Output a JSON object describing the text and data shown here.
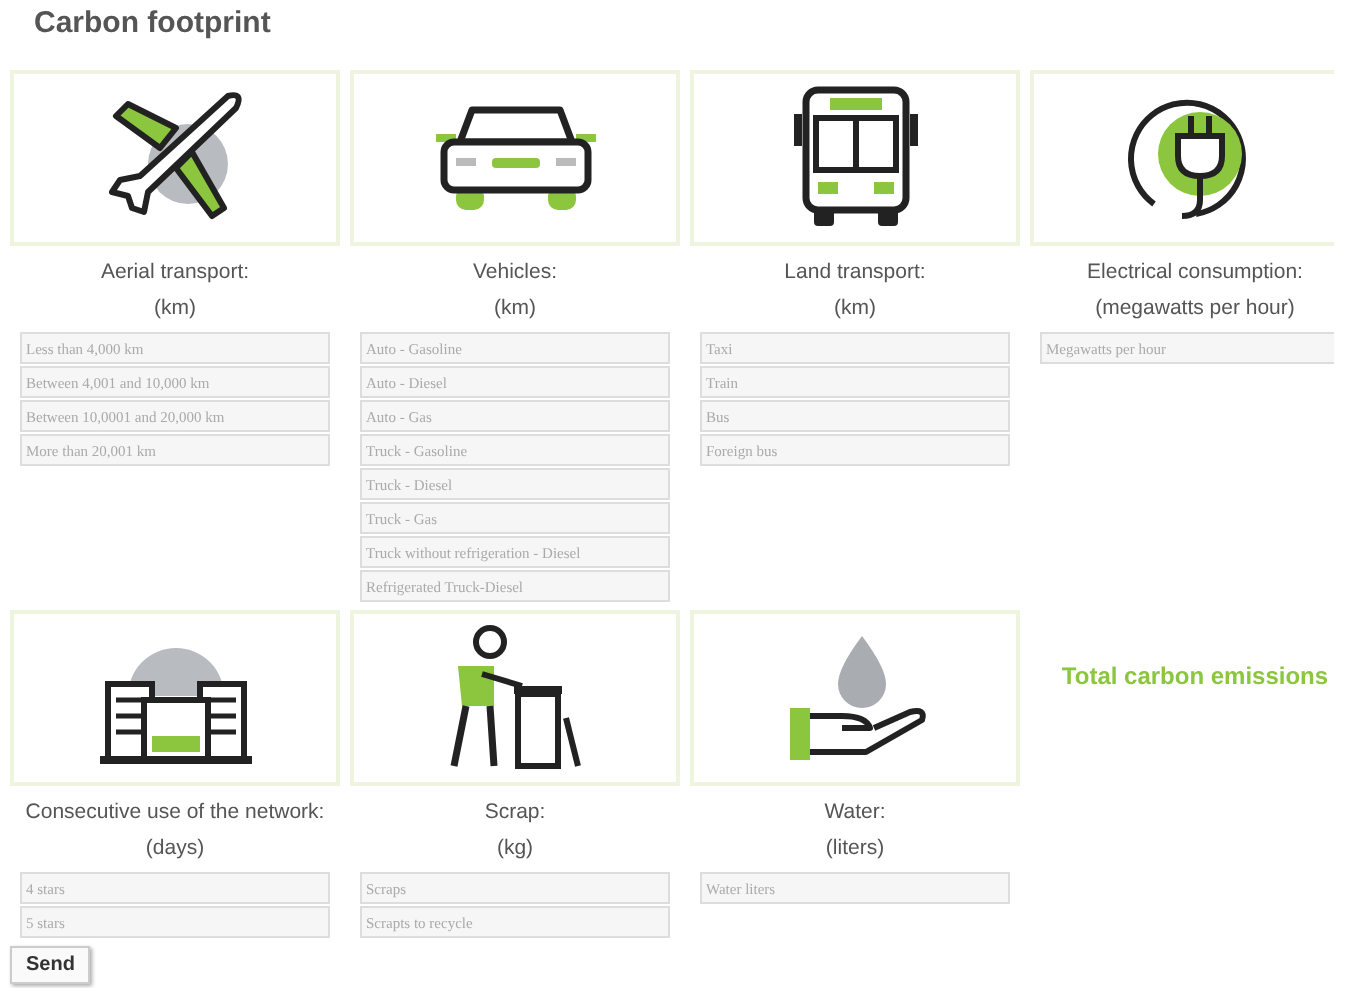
{
  "title": "Carbon footprint",
  "categories": [
    {
      "kind": "plane",
      "label": "Aerial transport:",
      "unit": "(km)",
      "fields": [
        {
          "placeholder": "Less than 4,000 km"
        },
        {
          "placeholder": "Between 4,001 and 10,000 km"
        },
        {
          "placeholder": "Between 10,0001 and 20,000 km"
        },
        {
          "placeholder": "More than 20,001 km"
        }
      ]
    },
    {
      "kind": "car",
      "label": "Vehicles:",
      "unit": "(km)",
      "fields": [
        {
          "placeholder": "Auto - Gasoline"
        },
        {
          "placeholder": "Auto - Diesel"
        },
        {
          "placeholder": "Auto - Gas"
        },
        {
          "placeholder": "Truck - Gasoline"
        },
        {
          "placeholder": "Truck - Diesel"
        },
        {
          "placeholder": "Truck - Gas"
        },
        {
          "placeholder": "Truck without refrigeration - Diesel"
        },
        {
          "placeholder": "Refrigerated Truck-Diesel"
        }
      ]
    },
    {
      "kind": "bus",
      "label": "Land transport:",
      "unit": "(km)",
      "fields": [
        {
          "placeholder": "Taxi"
        },
        {
          "placeholder": "Train"
        },
        {
          "placeholder": "Bus"
        },
        {
          "placeholder": "Foreign bus"
        }
      ]
    },
    {
      "kind": "plug",
      "label": "Electrical consumption:",
      "unit": "(megawatts per hour)",
      "fields": [
        {
          "placeholder": "Megawatts per hour"
        }
      ]
    },
    {
      "kind": "building",
      "label": "Consecutive use of the network:",
      "unit": "(days)",
      "fields": [
        {
          "placeholder": "4 stars"
        },
        {
          "placeholder": "5 stars"
        }
      ]
    },
    {
      "kind": "scrap",
      "label": "Scrap:",
      "unit": "(kg)",
      "fields": [
        {
          "placeholder": "Scraps"
        },
        {
          "placeholder": "Scrapts to recycle"
        }
      ]
    },
    {
      "kind": "water",
      "label": "Water:",
      "unit": "(liters)",
      "fields": [
        {
          "placeholder": "Water liters"
        }
      ]
    }
  ],
  "total_label": "Total carbon emissions",
  "send_button": "Send"
}
